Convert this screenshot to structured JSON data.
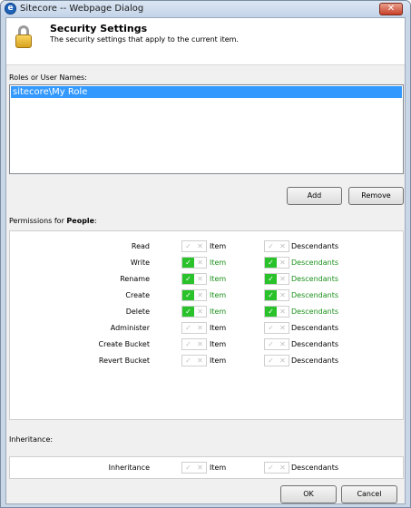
{
  "window": {
    "title": "Sitecore -- Webpage Dialog",
    "close_glyph": "✕"
  },
  "header": {
    "title": "Security Settings",
    "subtitle": "The security settings that apply to the current item."
  },
  "roles": {
    "label": "Roles or User Names:",
    "items": [
      "sitecore\\My Role"
    ],
    "add_label": "Add",
    "remove_label": "Remove"
  },
  "permissions": {
    "label_prefix": "Permissions for ",
    "label_subject": "People",
    "label_suffix": ":",
    "item_label": "Item",
    "descendants_label": "Descendants",
    "rows": [
      {
        "name": "Read",
        "item": false,
        "descendants": false
      },
      {
        "name": "Write",
        "item": true,
        "descendants": true
      },
      {
        "name": "Rename",
        "item": true,
        "descendants": true
      },
      {
        "name": "Create",
        "item": true,
        "descendants": true
      },
      {
        "name": "Delete",
        "item": true,
        "descendants": true
      },
      {
        "name": "Administer",
        "item": false,
        "descendants": false
      },
      {
        "name": "Create Bucket",
        "item": false,
        "descendants": false
      },
      {
        "name": "Revert Bucket",
        "item": false,
        "descendants": false
      }
    ]
  },
  "inheritance": {
    "label": "Inheritance:",
    "row_name": "Inheritance",
    "item_label": "Item",
    "descendants_label": "Descendants"
  },
  "footer": {
    "ok_label": "OK",
    "cancel_label": "Cancel"
  },
  "toggle_glyphs": {
    "allow": "✓",
    "deny": "✕"
  },
  "colors": {
    "selection": "#3399ff",
    "allow_green": "#29c22a",
    "allow_text": "#1a8f1a"
  }
}
